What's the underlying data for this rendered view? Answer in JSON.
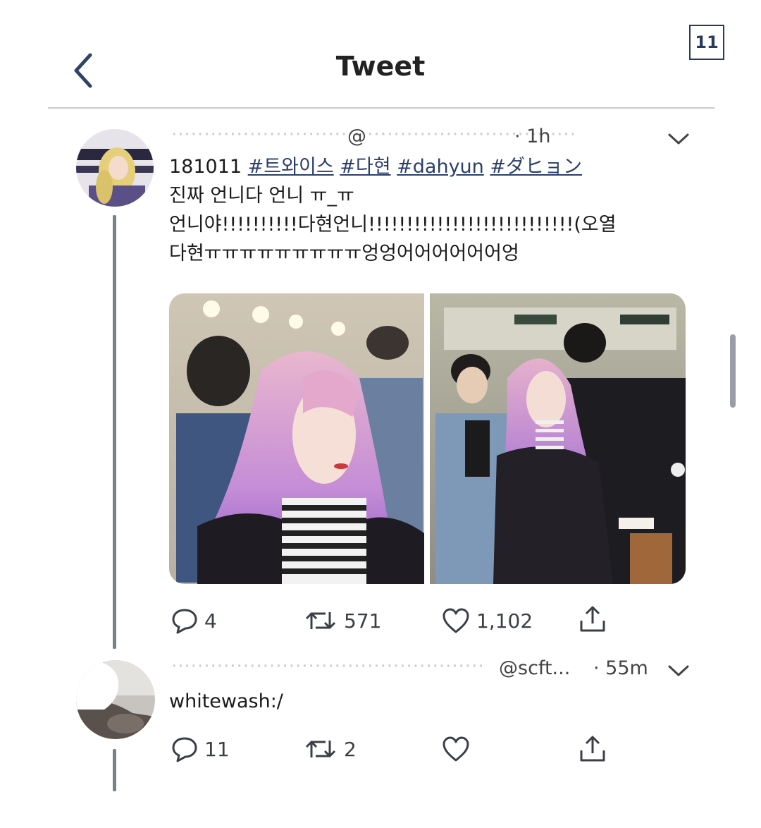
{
  "page_number": "11",
  "header": {
    "title": "Tweet"
  },
  "tweet": {
    "handle": "@",
    "time": "· 1h",
    "date_prefix": "181011",
    "hashtags": [
      "#트와이스",
      "#다현",
      "#dahyun",
      "#ダヒョン"
    ],
    "lines": [
      "진짜 언니다 언니 ㅠ_ㅠ",
      "언니야!!!!!!!!!!다현언니!!!!!!!!!!!!!!!!!!!!!!!!!!!(오열",
      "다현ㅠㅠㅠㅠㅠㅠㅠㅠㅠ엉엉어어어어어어엉"
    ],
    "actions": {
      "replies": "4",
      "retweets": "571",
      "likes": "1,102"
    }
  },
  "reply": {
    "handle": "@scft...",
    "time": "· 55m",
    "text": "whitewash:/",
    "actions": {
      "replies": "11",
      "retweets": "2"
    }
  },
  "icons": {
    "back": "chevron-left-icon",
    "more": "chevron-down-icon",
    "reply": "speech-bubble-icon",
    "retweet": "retweet-icon",
    "like": "heart-icon",
    "share": "share-icon"
  },
  "colors": {
    "hashtag": "#2c3f6c",
    "badge": "#2a3a5c",
    "thread_line": "#7b8088"
  }
}
